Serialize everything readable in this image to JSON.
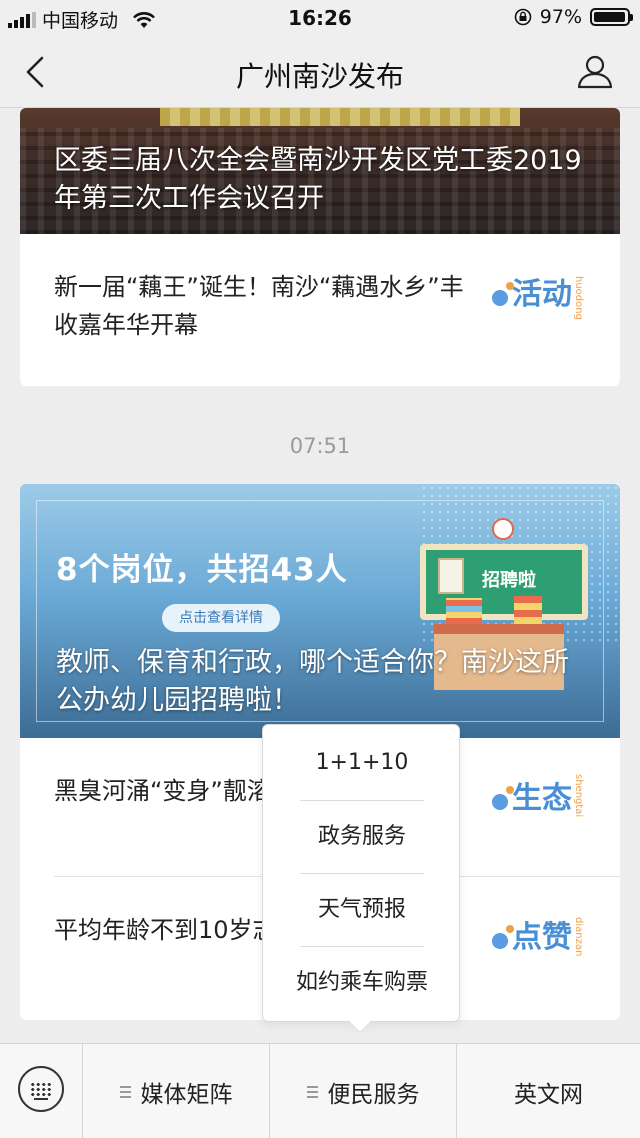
{
  "status_bar": {
    "carrier": "中国移动",
    "time": "16:26",
    "battery_percent": "97%",
    "battery_level": 0.97
  },
  "nav": {
    "title": "广州南沙发布"
  },
  "articles_group_1": {
    "headline": "区委三届八次全会暨南沙开发区党工委2019年第三次工作会议召开",
    "items": [
      {
        "text": "新一届“藕王”诞生！南沙“藕遇水乡”丰收嘉年华开幕",
        "badge": "活动",
        "badge_pinyin": "huodong"
      }
    ]
  },
  "timestamp": "07:51",
  "articles_group_2": {
    "banner_title": "8个岗位，共招43人",
    "banner_button": "点击查看详情",
    "banner_board": "招聘啦",
    "headline": "教师、保育和行政，哪个适合你？南沙这所公办幼儿园招聘啦！",
    "items": [
      {
        "text": "黑臭河涌“变身”靓溶涌，隔着屏幕都",
        "badge": "生态",
        "badge_pinyin": "shengtai"
      },
      {
        "text": "平均年龄不到10岁志愿服务队，有多",
        "badge": "点赞",
        "badge_pinyin": "dianzan"
      }
    ]
  },
  "popup_menu": {
    "items": [
      "1+1+10",
      "政务服务",
      "天气预报",
      "如约乘车购票"
    ]
  },
  "bottom_menu": {
    "tabs": [
      "媒体矩阵",
      "便民服务",
      "英文网"
    ]
  },
  "colors": {
    "badge_blue": "#4a8fd6",
    "badge_orange": "#f0a148",
    "accent_dot_blue": "#5b9be0"
  }
}
